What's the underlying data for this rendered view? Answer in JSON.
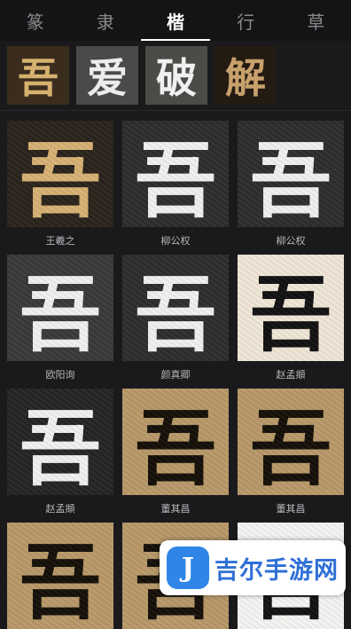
{
  "tabs": [
    {
      "label": "篆",
      "active": false
    },
    {
      "label": "隶",
      "active": false
    },
    {
      "label": "楷",
      "active": true
    },
    {
      "label": "行",
      "active": false
    },
    {
      "label": "草",
      "active": false
    }
  ],
  "strip": {
    "glyphs": [
      "吾",
      "爱",
      "破",
      "解"
    ]
  },
  "grid": [
    {
      "glyph": "吾",
      "author": "王羲之"
    },
    {
      "glyph": "吾",
      "author": "柳公权"
    },
    {
      "glyph": "吾",
      "author": "柳公权"
    },
    {
      "glyph": "吾",
      "author": "欧阳询"
    },
    {
      "glyph": "吾",
      "author": "颜真卿"
    },
    {
      "glyph": "吾",
      "author": "赵孟頫"
    },
    {
      "glyph": "吾",
      "author": "赵孟頫"
    },
    {
      "glyph": "吾",
      "author": "董其昌"
    },
    {
      "glyph": "吾",
      "author": "董其昌"
    },
    {
      "glyph": "吾",
      "author": ""
    },
    {
      "glyph": "吾",
      "author": ""
    },
    {
      "glyph": "吾",
      "author": ""
    }
  ],
  "watermark": {
    "logo_letter": "J",
    "text": "吉尔手游网"
  },
  "colors": {
    "background": "#1a1a1c",
    "tab_bar": "#141416",
    "active_tab": "#ffffff",
    "inactive_tab": "#8a8a8d",
    "watermark_blue": "#2f86e6"
  }
}
